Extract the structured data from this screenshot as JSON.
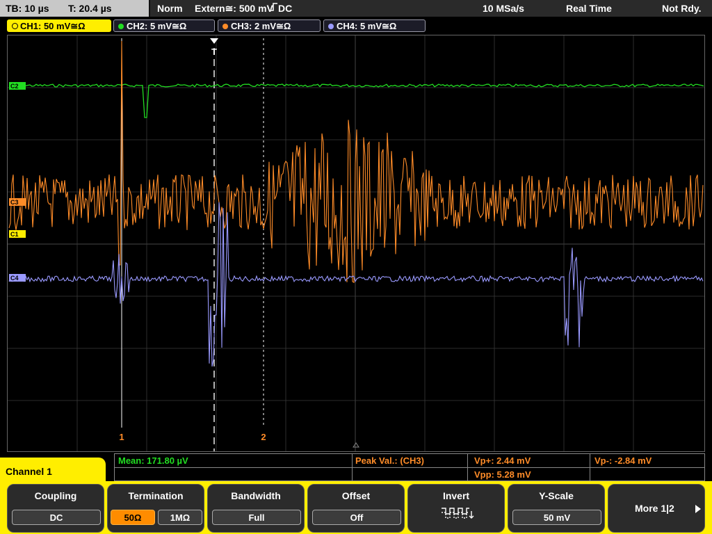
{
  "topbar": {
    "timebase": "TB: 10 µs",
    "trigger_time": "T: 20.4 µs",
    "mode": "Norm",
    "trigger_source": "Extern≅: 500 mV",
    "trigger_coupling": "DC",
    "sample_rate": "10 MSa/s",
    "acq_mode": "Real Time",
    "status": "Not Rdy."
  },
  "channels": [
    {
      "label": "CH1: 50 mV≅Ω",
      "color": "#ffee00",
      "active": true
    },
    {
      "label": "CH2: 5 mV≅Ω",
      "color": "#22dd22",
      "active": false
    },
    {
      "label": "CH3: 2 mV≅Ω",
      "color": "#ff8c28",
      "active": false
    },
    {
      "label": "CH4: 5 mV≅Ω",
      "color": "#9a9aff",
      "active": false
    }
  ],
  "markers": {
    "ch1": "C1",
    "ch2": "C2",
    "ch3": "C3",
    "ch4": "C4",
    "trigger": "T",
    "cursor1": "1",
    "cursor2": "2"
  },
  "measurements": {
    "mean": "Mean: 171.80 µV",
    "peak_label": "Peak Val.:  (CH3)",
    "vp_plus": "Vp+: 2.44 mV",
    "vp_minus": "Vp-: -2.84 mV",
    "vpp": "Vpp: 5.28 mV"
  },
  "panel": {
    "channel_label": "Channel 1"
  },
  "softkeys": {
    "coupling": {
      "title": "Coupling",
      "value": "DC"
    },
    "termination": {
      "title": "Termination",
      "opt1": "50Ω",
      "opt2": "1MΩ"
    },
    "bandwidth": {
      "title": "Bandwidth",
      "value": "Full"
    },
    "offset": {
      "title": "Offset",
      "value": "Off"
    },
    "invert": {
      "title": "Invert"
    },
    "yscale": {
      "title": "Y-Scale",
      "value": "50 mV"
    },
    "more": {
      "title": "More 1|2"
    }
  },
  "colors": {
    "ch1": "#ffee00",
    "ch2": "#22dd22",
    "ch3": "#ff8c28",
    "ch4": "#9a9aff",
    "grid": "#3a3a3a"
  }
}
